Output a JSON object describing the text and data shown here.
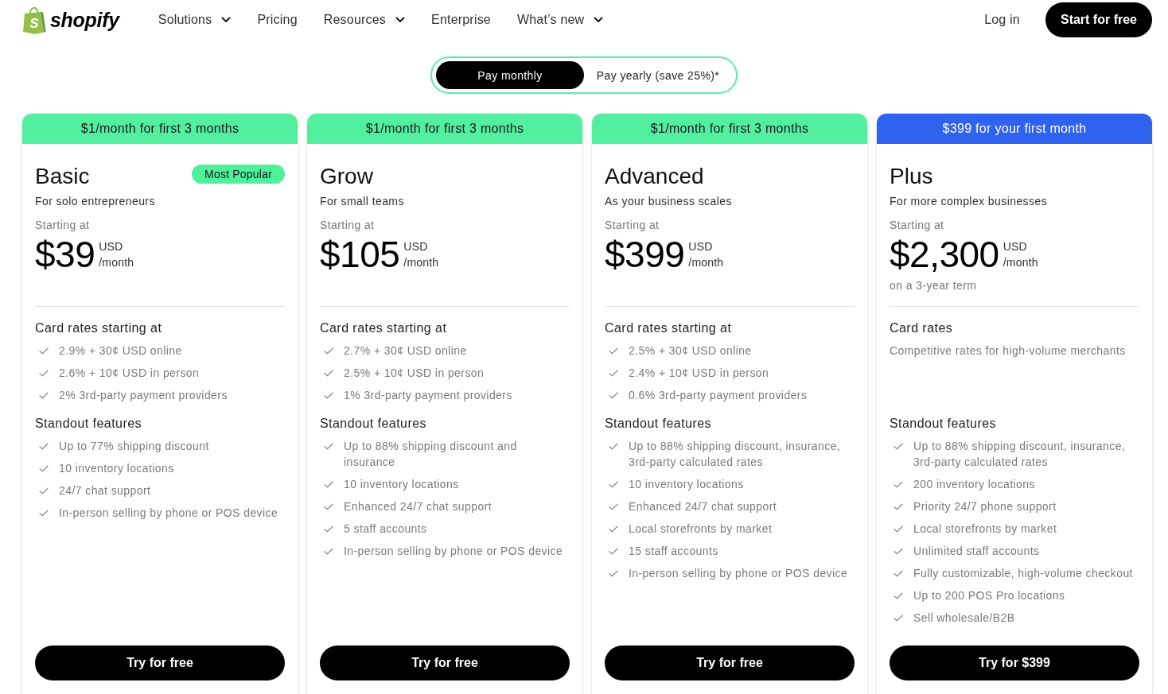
{
  "nav": {
    "logo": {
      "mark": "S",
      "wordmark": "shopify"
    },
    "items": [
      {
        "label": "Solutions",
        "dropdown": true
      },
      {
        "label": "Pricing",
        "dropdown": false
      },
      {
        "label": "Resources",
        "dropdown": true
      },
      {
        "label": "Enterprise",
        "dropdown": false
      },
      {
        "label": "What’s new",
        "dropdown": true
      }
    ],
    "login": "Log in",
    "cta": "Start for free"
  },
  "billing_toggle": {
    "options": [
      {
        "label": "Pay monthly",
        "selected": true
      },
      {
        "label": "Pay yearly (save 25%)*",
        "selected": false
      }
    ]
  },
  "plans": [
    {
      "banner": "$1/month for first 3 months",
      "color": "#52f09e",
      "name": "Basic",
      "badge": "Most Popular",
      "tagline": "For solo entrepreneurs",
      "price_label": "Starting at",
      "price": "$39",
      "currency": "USD",
      "period": "/month",
      "card_rates": {
        "heading": "Card rates starting at",
        "items": [
          "2.9% + 30¢ USD online",
          "2.6% + 10¢ USD in person",
          "2% 3rd-party payment providers"
        ]
      },
      "features": {
        "heading": "Standout features",
        "items": [
          "Up to 77% shipping discount",
          "10 inventory locations",
          "24/7 chat support",
          "In-person selling by phone or POS device"
        ]
      },
      "button": "Try for free"
    },
    {
      "banner": "$1/month for first 3 months",
      "color": "#52f09e",
      "name": "Grow",
      "tagline": "For small teams",
      "price_label": "Starting at",
      "price": "$105",
      "currency": "USD",
      "period": "/month",
      "card_rates": {
        "heading": "Card rates starting at",
        "items": [
          "2.7% + 30¢ USD online",
          "2.5% + 10¢ USD in person",
          "1% 3rd-party payment providers"
        ]
      },
      "features": {
        "heading": "Standout features",
        "items": [
          "Up to 88% shipping discount and insurance",
          "10 inventory locations",
          "Enhanced 24/7 chat support",
          "5 staff accounts",
          "In-person selling by phone or POS device"
        ]
      },
      "button": "Try for free"
    },
    {
      "banner": "$1/month for first 3 months",
      "color": "#52f09e",
      "name": "Advanced",
      "tagline": "As your business scales",
      "price_label": "Starting at",
      "price": "$399",
      "currency": "USD",
      "period": "/month",
      "card_rates": {
        "heading": "Card rates starting at",
        "items": [
          "2.5% + 30¢ USD online",
          "2.4% + 10¢ USD in person",
          "0.6% 3rd-party payment providers"
        ]
      },
      "features": {
        "heading": "Standout features",
        "items": [
          "Up to 88% shipping discount, insurance, 3rd-party calculated rates",
          "10 inventory locations",
          "Enhanced 24/7 chat support",
          "Local storefronts by market",
          "15 staff accounts",
          "In-person selling by phone or POS device"
        ]
      },
      "button": "Try for free"
    },
    {
      "banner": "$399 for your first month",
      "color": "#2e62ef",
      "name": "Plus",
      "tagline": "For more complex businesses",
      "price_label": "Starting at",
      "price": "$2,300",
      "currency": "USD",
      "period": "/month",
      "term": "on a 3-year term",
      "card_rates": {
        "heading": "Card rates",
        "description": "Competitive rates for high-volume merchants"
      },
      "features": {
        "heading": "Standout features",
        "items": [
          "Up to 88% shipping discount, insurance, 3rd-party calculated rates",
          "200 inventory locations",
          "Priority 24/7 phone support",
          "Local storefronts by market",
          "Unlimited staff accounts",
          "Fully customizable, high-volume checkout",
          "Up to 200 POS Pro locations",
          "Sell wholesale/B2B"
        ]
      },
      "button": "Try for $399"
    }
  ]
}
